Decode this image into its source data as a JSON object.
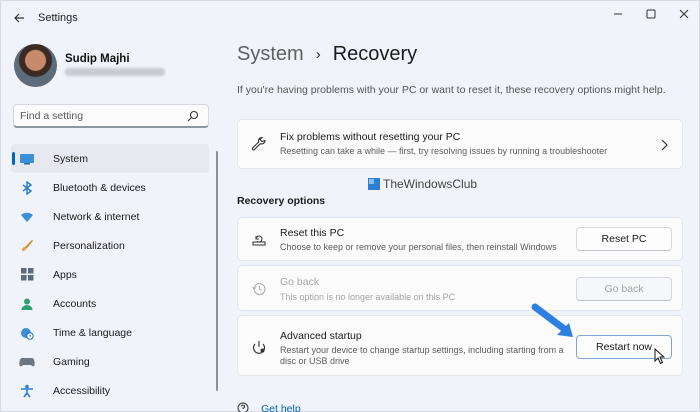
{
  "window": {
    "app_title": "Settings",
    "accent": "#0067c0"
  },
  "user": {
    "name": "Sudip Majhi"
  },
  "search": {
    "placeholder": "Find a setting"
  },
  "sidebar": {
    "items": [
      {
        "label": "System",
        "icon": "monitor-icon",
        "active": true
      },
      {
        "label": "Bluetooth & devices",
        "icon": "bluetooth-icon"
      },
      {
        "label": "Network & internet",
        "icon": "wifi-icon"
      },
      {
        "label": "Personalization",
        "icon": "brush-icon"
      },
      {
        "label": "Apps",
        "icon": "apps-icon"
      },
      {
        "label": "Accounts",
        "icon": "person-icon"
      },
      {
        "label": "Time & language",
        "icon": "globe-clock-icon"
      },
      {
        "label": "Gaming",
        "icon": "gamepad-icon"
      },
      {
        "label": "Accessibility",
        "icon": "accessibility-icon"
      }
    ]
  },
  "main": {
    "breadcrumb": {
      "parent": "System",
      "separator": "›",
      "current": "Recovery"
    },
    "intro": "If you're having problems with your PC or want to reset it, these recovery options might help.",
    "fix_card": {
      "title": "Fix problems without resetting your PC",
      "desc": "Resetting can take a while — first, try resolving issues by running a troubleshooter"
    },
    "section_label": "Recovery options",
    "watermark": "TheWindowsClub",
    "options": [
      {
        "title": "Reset this PC",
        "desc": "Choose to keep or remove your personal files, then reinstall Windows",
        "button": "Reset PC",
        "enabled": true
      },
      {
        "title": "Go back",
        "desc": "This option is no longer available on this PC",
        "button": "Go back",
        "enabled": false
      },
      {
        "title": "Advanced startup",
        "desc": "Restart your device to change startup settings, including starting from a disc or USB drive",
        "button": "Restart now",
        "enabled": true
      }
    ],
    "get_help": "Get help"
  }
}
